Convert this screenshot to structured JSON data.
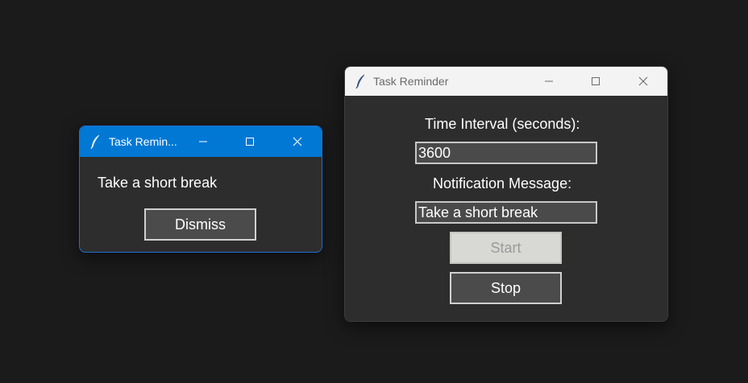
{
  "popup": {
    "title": "Task Remin...",
    "message": "Take a short break",
    "dismiss_label": "Dismiss"
  },
  "main": {
    "title": "Task Reminder",
    "interval_label": "Time Interval (seconds):",
    "interval_value": "3600",
    "message_label": "Notification Message:",
    "message_value": "Take a short break",
    "start_label": "Start",
    "start_state": "disabled",
    "stop_label": "Stop"
  },
  "icons": {
    "app": "feather-icon",
    "minimize": "minimize-icon",
    "maximize": "maximize-icon",
    "close": "close-icon"
  },
  "colors": {
    "desktop": "#1b1b1b",
    "window_bg": "#2d2d2d",
    "active_titlebar": "#0078d4",
    "inactive_titlebar": "#f3f3f3",
    "entry_bg": "#4a4a4a",
    "button_bg": "#4b4b4b",
    "disabled_button_bg": "#d8d8d4"
  }
}
